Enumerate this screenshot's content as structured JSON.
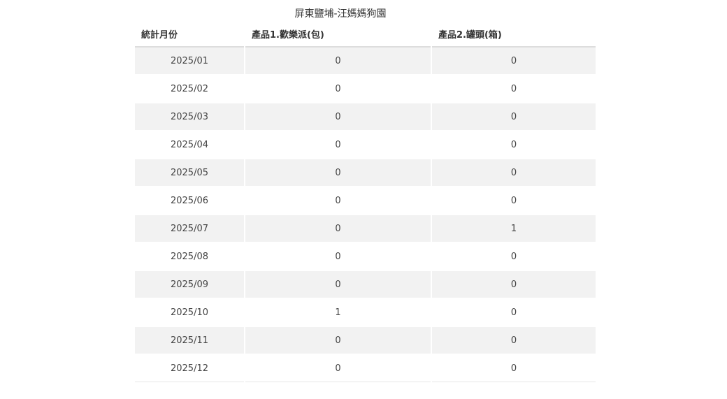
{
  "page": {
    "title": "屏東鹽埔-汪媽媽狗園"
  },
  "table": {
    "headers": [
      "統計月份",
      "產品1.歡樂派(包)",
      "產品2.罐頭(箱)"
    ],
    "rows": [
      [
        "2025/01",
        "0",
        "0"
      ],
      [
        "2025/02",
        "0",
        "0"
      ],
      [
        "2025/03",
        "0",
        "0"
      ],
      [
        "2025/04",
        "0",
        "0"
      ],
      [
        "2025/05",
        "0",
        "0"
      ],
      [
        "2025/06",
        "0",
        "0"
      ],
      [
        "2025/07",
        "0",
        "1"
      ],
      [
        "2025/08",
        "0",
        "0"
      ],
      [
        "2025/09",
        "0",
        "0"
      ],
      [
        "2025/10",
        "1",
        "0"
      ],
      [
        "2025/11",
        "0",
        "0"
      ],
      [
        "2025/12",
        "0",
        "0"
      ]
    ]
  },
  "colors": {
    "stripe": "#f2f2f2",
    "header_border": "#dddddd",
    "text": "#333333"
  }
}
